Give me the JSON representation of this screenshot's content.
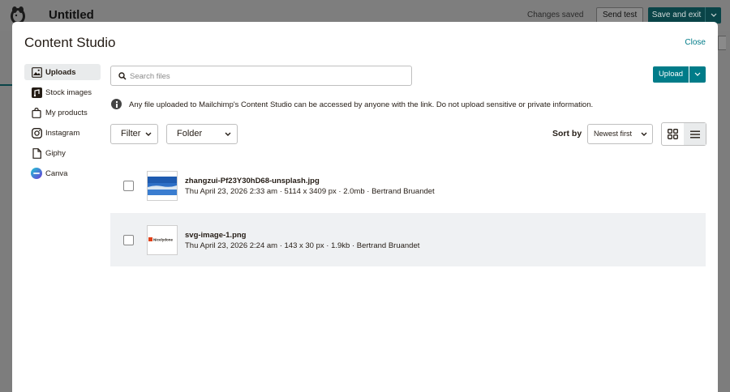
{
  "app": {
    "doc_title": "Untitled",
    "changes_status": "Changes saved",
    "send_test": "Send test",
    "save_exit": "Save and exit"
  },
  "modal": {
    "title": "Content Studio",
    "close": "Close"
  },
  "sidebar": {
    "items": [
      {
        "label": "Uploads",
        "icon": "image-icon",
        "active": true
      },
      {
        "label": "Stock images",
        "icon": "stock-images-icon"
      },
      {
        "label": "My products",
        "icon": "shopping-bag-icon"
      },
      {
        "label": "Instagram",
        "icon": "instagram-icon"
      },
      {
        "label": "Giphy",
        "icon": "file-icon"
      },
      {
        "label": "Canva",
        "icon": "canva-logo-icon"
      }
    ]
  },
  "search": {
    "placeholder": "Search files",
    "value": ""
  },
  "upload": {
    "label": "Upload"
  },
  "notice": "Any file uploaded to Mailchimp's Content Studio can be accessed by anyone with the link. Do not upload sensitive or private information.",
  "filters": {
    "filter": "Filter",
    "folder": "Folder",
    "sort_label": "Sort by",
    "sort_value": "Newest first"
  },
  "files": [
    {
      "name": "zhangzui-Pf23Y30hD68-unsplash.jpg",
      "meta": "Thu April 23, 2026 2:33 am · 5114 x 3409 px · 2.0mb · Bertrand Bruandet",
      "selected": false
    },
    {
      "name": "svg-image-1.png",
      "meta": "Thu April 23, 2026 2:24 am · 143 x 30 px · 1.9kb · Bertrand Bruandet",
      "selected": true,
      "thumb_text": "Nicelydone"
    }
  ],
  "colors": {
    "accent": "#007c89",
    "dark_teal": "#0a4448",
    "selected_row": "#eff1f3"
  }
}
